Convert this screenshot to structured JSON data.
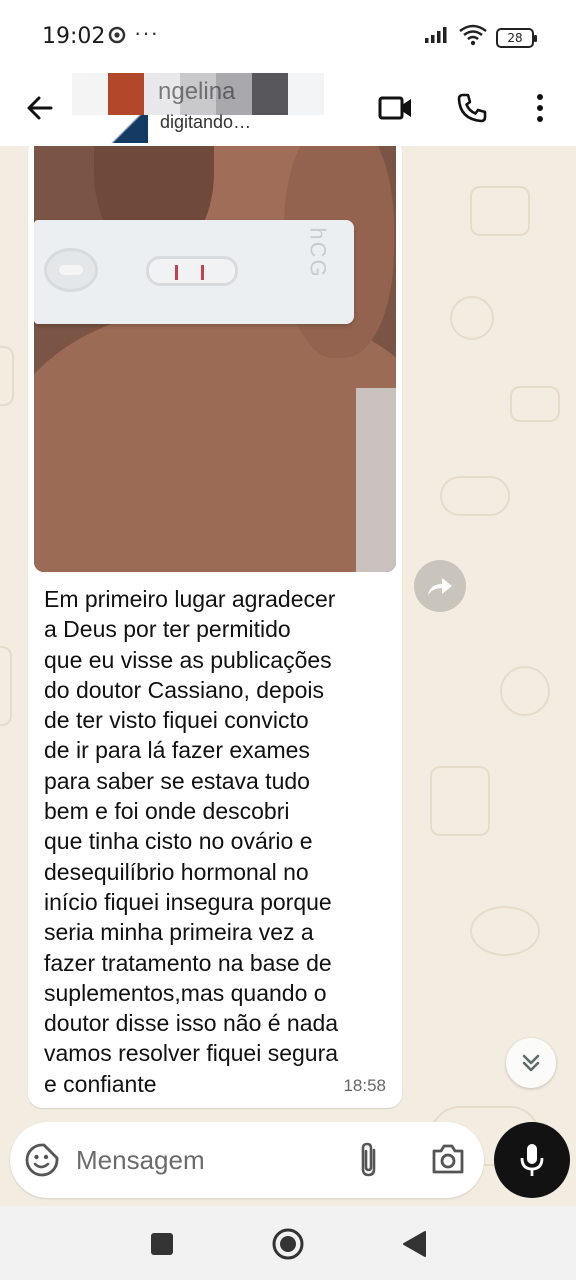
{
  "status_bar": {
    "time": "19:02",
    "dots": "···",
    "battery": "28",
    "icons": [
      "chrome-icon",
      "signal-icon",
      "wifi-icon",
      "battery-icon"
    ]
  },
  "header": {
    "contact_name": "ngelina",
    "contact_status": "digitando…",
    "icons": [
      "back-arrow-icon",
      "video-call-icon",
      "phone-icon",
      "more-vert-icon"
    ]
  },
  "message": {
    "lines": [
      "Em primeiro lugar agradecer",
      "a Deus por ter permitido",
      "que eu visse as publicações",
      "do doutor Cassiano, depois",
      "de ter visto fiquei convicto",
      "de ir para lá fazer exames",
      "para saber se estava tudo",
      "bem e foi onde descobri",
      "que tinha cisto no ovário e",
      "desequilíbrio hormonal no",
      "início fiquei insegura porque",
      "seria minha primeira vez a",
      "fazer tratamento na base de",
      "suplementos,mas quando o",
      "doutor disse isso não é nada",
      "vamos resolver fiquei segura",
      "e confiante"
    ],
    "time": "18:58",
    "photo_strip_label": "hCG"
  },
  "composer": {
    "placeholder": "Mensagem",
    "icons": [
      "sticker-icon",
      "attach-icon",
      "camera-icon",
      "mic-icon"
    ]
  },
  "colors": {
    "chat_bg": "#f2ece1",
    "bubble": "#ffffff",
    "mic_button": "#121212",
    "test_line": "#c6404f"
  }
}
